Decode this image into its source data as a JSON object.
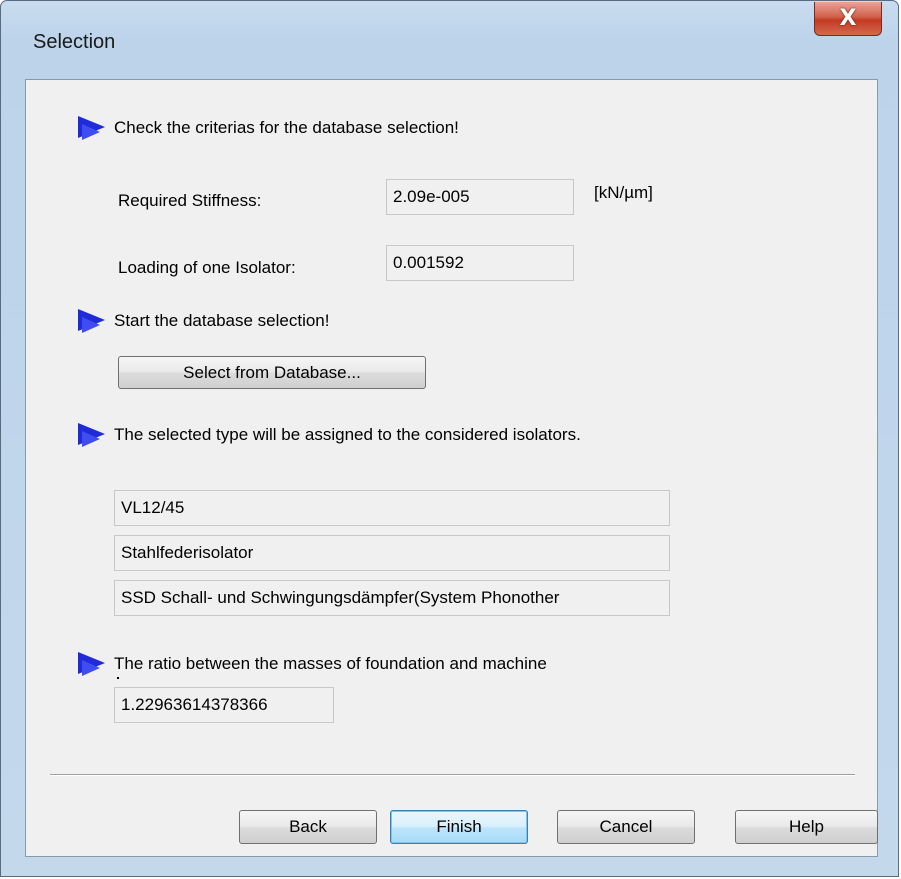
{
  "window": {
    "title": "Selection",
    "close_glyph": "X"
  },
  "section1": {
    "instruction": "Check the criterias for the database selection!",
    "stiffness_label": "Required Stiffness:",
    "stiffness_value": "2.09e-005",
    "stiffness_unit": "[kN/µm]",
    "loading_label": "Loading of one Isolator:",
    "loading_value": "0.001592"
  },
  "section2": {
    "instruction": "Start the database selection!",
    "select_button": "Select from Database..."
  },
  "section3": {
    "instruction": "The selected type will be assigned to the considered isolators.",
    "type_name": "VL12/45",
    "type_kind": "Stahlfederisolator",
    "manufacturer": "SSD Schall- und Schwingungsdämpfer(System Phonother"
  },
  "section4": {
    "instruction": "The ratio between the masses of foundation and machine",
    "ratio_value": "1.22963614378366"
  },
  "buttons": {
    "back": "Back",
    "finish": "Finish",
    "cancel": "Cancel",
    "help": "Help"
  },
  "icons": {
    "bullet": "arrow-right-icon",
    "close": "close-icon"
  },
  "colors": {
    "bullet_arrow": "#1f2ad8",
    "close_button": "#c23a22"
  }
}
